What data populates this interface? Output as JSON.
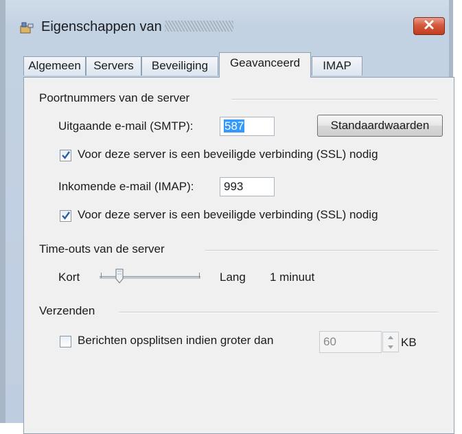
{
  "window": {
    "title_prefix": "Eigenschappen van"
  },
  "tabs": [
    {
      "label": "Algemeen"
    },
    {
      "label": "Servers"
    },
    {
      "label": "Beveiliging"
    },
    {
      "label": "Geavanceerd",
      "active": true
    },
    {
      "label": "IMAP"
    }
  ],
  "ports": {
    "group_label": "Poortnummers van de server",
    "smtp_label": "Uitgaande e-mail (SMTP):",
    "smtp_value": "587",
    "defaults_button": "Standaardwaarden",
    "smtp_ssl_label": "Voor deze server is een beveiligde verbinding (SSL) nodig",
    "smtp_ssl_checked": true,
    "imap_label": "Inkomende e-mail (IMAP):",
    "imap_value": "993",
    "imap_ssl_label": "Voor deze server is een beveiligde verbinding (SSL) nodig",
    "imap_ssl_checked": true
  },
  "timeouts": {
    "group_label": "Time-outs van de server",
    "short_label": "Kort",
    "long_label": "Lang",
    "value_text": "1 minuut",
    "slider_level": 0.2
  },
  "sending": {
    "group_label": "Verzenden",
    "split_label": "Berichten opsplitsen indien groter dan",
    "split_checked": false,
    "size_value": "60",
    "size_unit": "KB"
  },
  "colors": {
    "close_button": "#c23b1f",
    "selection": "#3399ff",
    "check": "#2b5ea8"
  }
}
